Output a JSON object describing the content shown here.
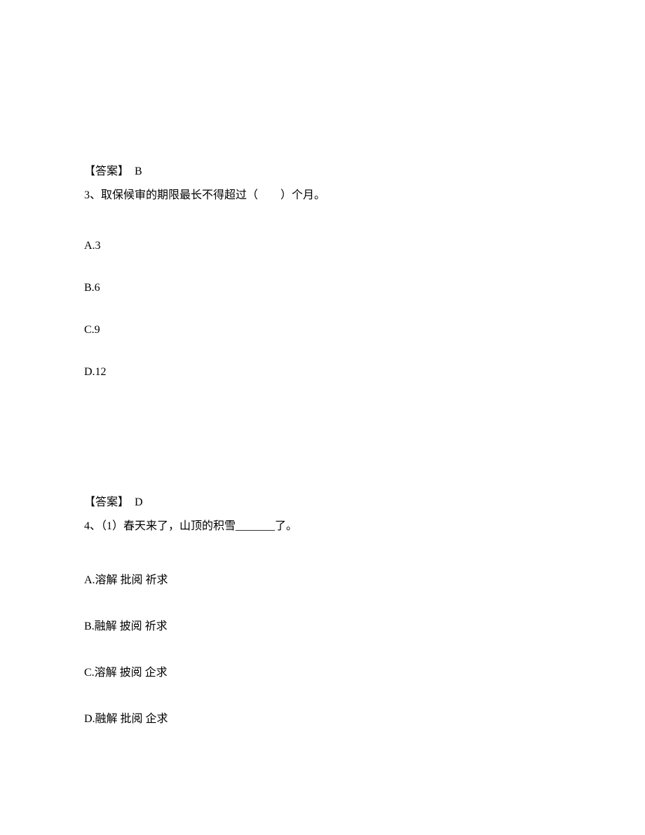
{
  "answer1": {
    "label": "【答案】",
    "value": "B"
  },
  "question3": {
    "number": "3、",
    "text": "取保候审的期限最长不得超过（　　）个月。",
    "options": {
      "a": "A.3",
      "b": "B.6",
      "c": "C.9",
      "d": "D.12"
    }
  },
  "answer2": {
    "label": "【答案】",
    "value": "D"
  },
  "question4": {
    "number": "4、",
    "text": "（1）春天来了，山顶的积雪_______了。",
    "options": {
      "a": "A.溶解 批阅 祈求",
      "b": "B.融解 披阅 祈求",
      "c": "C.溶解 披阅 企求",
      "d": "D.融解 批阅 企求"
    }
  }
}
